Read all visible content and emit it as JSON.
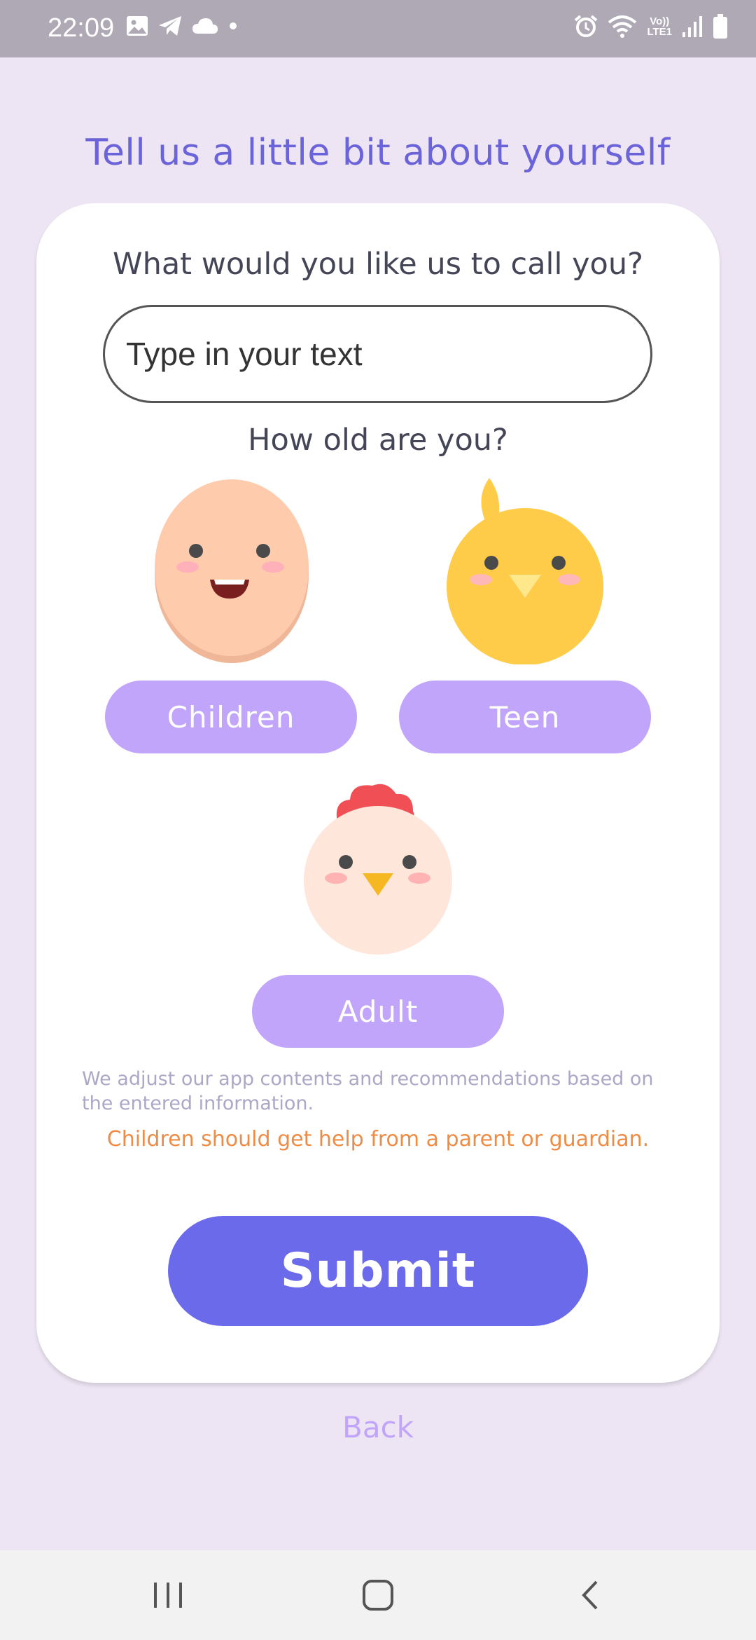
{
  "status_bar": {
    "time": "22:09",
    "left_icons": [
      "image-icon",
      "telegram-icon",
      "cloud-icon",
      "dot-icon"
    ],
    "right_icons": [
      "alarm-icon",
      "wifi-icon",
      "volte-icon",
      "signal-icon",
      "battery-icon"
    ],
    "volte_line1": "Vo))",
    "volte_line2": "LTE1"
  },
  "page": {
    "title": "Tell us a little bit about yourself"
  },
  "form": {
    "name_question": "What would you like us to call you?",
    "name_input_placeholder": "Type in your text",
    "name_input_value": "",
    "age_question": "How old are you?",
    "age_options": [
      {
        "label": "Children",
        "avatar": "egg-face-icon"
      },
      {
        "label": "Teen",
        "avatar": "chick-icon"
      },
      {
        "label": "Adult",
        "avatar": "chicken-icon"
      }
    ],
    "note": "We adjust our app contents and recommendations based on the entered information.",
    "warning": "Children should get help from a parent or guardian.",
    "submit_label": "Submit"
  },
  "footer": {
    "back_label": "Back"
  },
  "nav_bar": {
    "buttons": [
      "recents-icon",
      "home-icon",
      "back-icon"
    ]
  },
  "colors": {
    "background": "#ede5f3",
    "accent": "#6b63d9",
    "option_button": "#c1a5fb",
    "submit_button": "#6b6aeb",
    "warning": "#ee8b44"
  }
}
